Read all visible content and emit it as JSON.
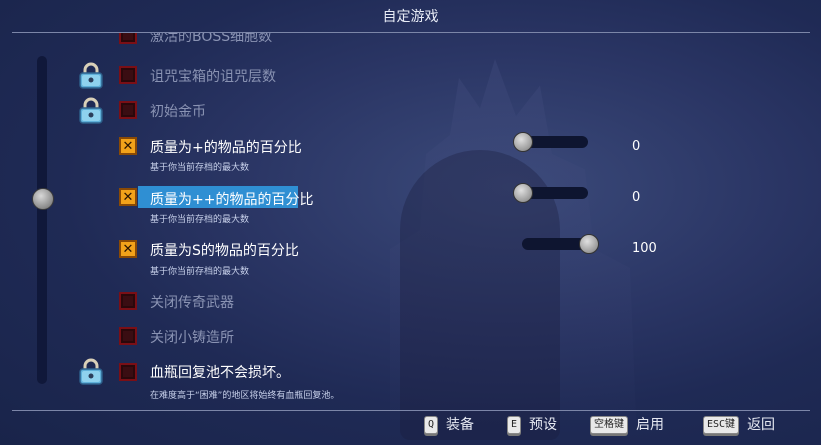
{
  "window": {
    "title": "自定游戏"
  },
  "options": [
    {
      "label": "激活的BOSS细胞数",
      "enabled": false,
      "locked": false
    },
    {
      "label": "诅咒宝箱的诅咒层数",
      "enabled": false,
      "locked": true
    },
    {
      "label": "初始金币",
      "enabled": false,
      "locked": true
    },
    {
      "label": "质量为+的物品的百分比",
      "enabled": true,
      "locked": false,
      "subtitle": "基于你当前存档的最大数",
      "value": "0"
    },
    {
      "label": "质量为++的物品的百分比",
      "enabled": true,
      "locked": false,
      "subtitle": "基于你当前存档的最大数",
      "value": "0",
      "selected": true
    },
    {
      "label": "质量为S的物品的百分比",
      "enabled": true,
      "locked": false,
      "subtitle": "基于你当前存档的最大数",
      "value": "100"
    },
    {
      "label": "关闭传奇武器",
      "enabled": false,
      "locked": false
    },
    {
      "label": "关闭小铸造所",
      "enabled": false,
      "locked": false
    },
    {
      "label": "血瓶回复池不会损坏。",
      "enabled": false,
      "locked": true,
      "subtitle": "在难度高于“困难”的地区将始终有血瓶回复池。"
    }
  ],
  "sliders": [
    {
      "level_percent": 0
    },
    {
      "level_percent": 0
    },
    {
      "level_percent": 100
    }
  ],
  "footer": {
    "equip": {
      "key": "Q",
      "label": "装备"
    },
    "preset": {
      "key": "E",
      "label": "预设"
    },
    "enable": {
      "key": "空格键",
      "label": "启用"
    },
    "back": {
      "key": "ESC键",
      "label": "返回"
    }
  },
  "colors": {
    "checkbox_on": "#f2a21a",
    "checkbox_off": "#7a0f16",
    "highlight": "#2f8fd3"
  },
  "icons": {
    "lock": "padlock-icon",
    "check": "x-mark-icon"
  }
}
